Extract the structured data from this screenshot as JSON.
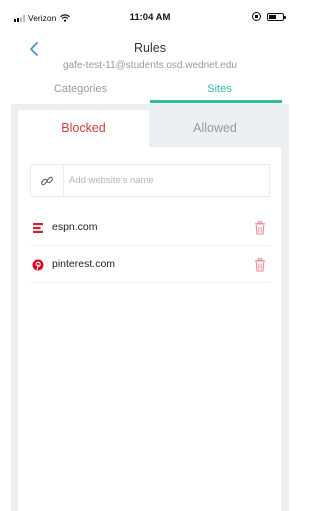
{
  "status_bar": {
    "carrier": "Verizon",
    "time": "11:04 AM"
  },
  "header": {
    "title": "Rules",
    "subtitle": "gafe-test-11@students.osd.wednet.edu"
  },
  "tabs": [
    {
      "label": "Categories",
      "active": false
    },
    {
      "label": "Sites",
      "active": true
    }
  ],
  "segments": [
    {
      "label": "Blocked",
      "active": true
    },
    {
      "label": "Allowed",
      "active": false
    }
  ],
  "add_site": {
    "placeholder": "Add website's name",
    "value": ""
  },
  "sites": [
    {
      "name": "espn.com",
      "icon": "espn-logo-icon"
    },
    {
      "name": "pinterest.com",
      "icon": "pinterest-logo-icon"
    }
  ],
  "colors": {
    "accent": "#2bbfa4",
    "blocked": "#e0383e",
    "delete": "#f08a8e",
    "muted": "#9a9a9a",
    "panel_bg": "#eceff1"
  }
}
